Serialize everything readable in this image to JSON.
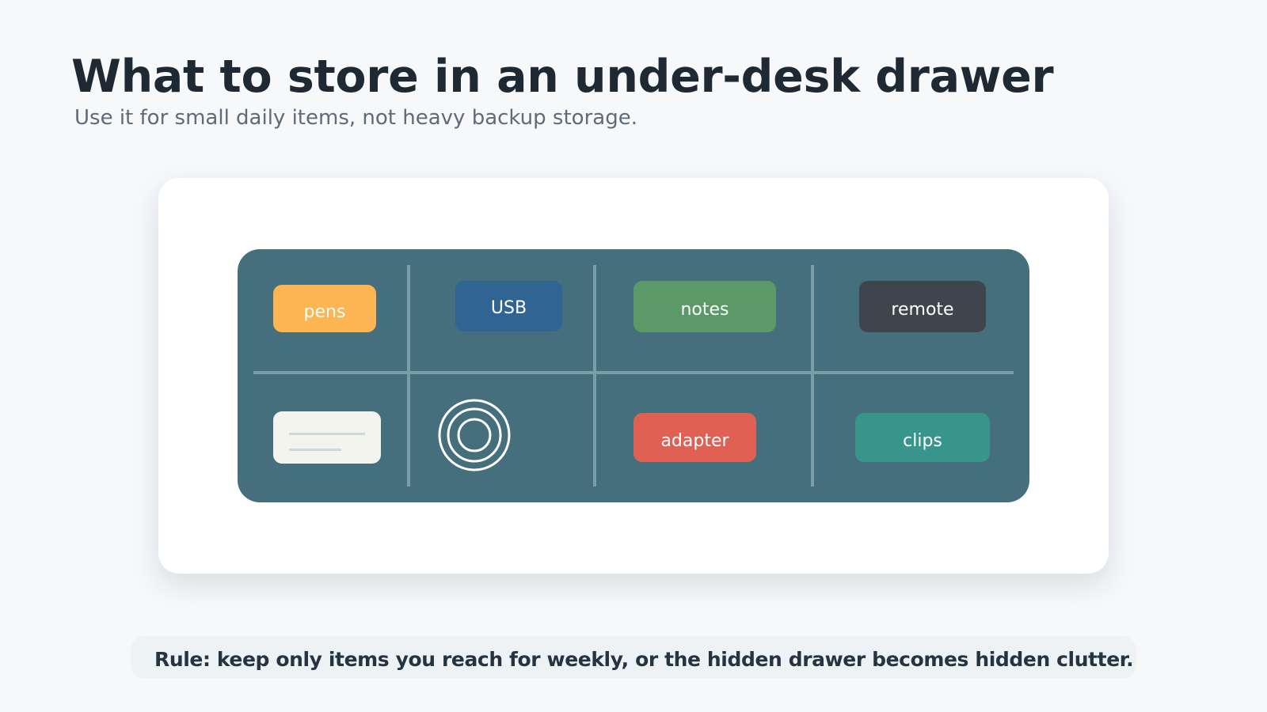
{
  "header": {
    "title": "What to store in an under-desk drawer",
    "subtitle": "Use it for small daily items, not heavy backup storage."
  },
  "drawer": {
    "color": "#456f7c",
    "divider_color": "#7a9ea8",
    "items": [
      {
        "label": "pens",
        "color": "#fdb554"
      },
      {
        "label": "USB",
        "color": "#306492"
      },
      {
        "label": "notes",
        "color": "#5b9a68"
      },
      {
        "label": "remote",
        "color": "#3f454c"
      },
      {
        "label": "adapter",
        "color": "#e06153"
      },
      {
        "label": "clips",
        "color": "#37958b"
      }
    ],
    "icons": [
      "notepad-icon",
      "tape-roll-icon"
    ]
  },
  "footer": {
    "rule": "Rule: keep only items you reach for weekly, or the hidden drawer becomes hidden clutter."
  }
}
